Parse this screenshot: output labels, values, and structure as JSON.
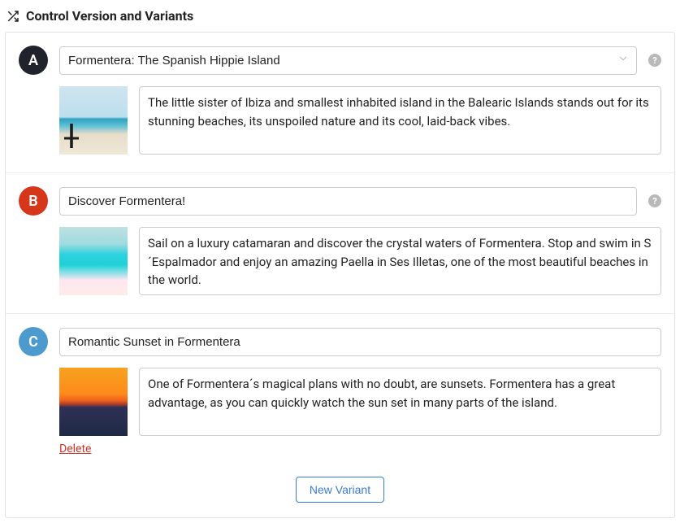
{
  "header": {
    "title": "Control Version and Variants"
  },
  "variants": [
    {
      "letter": "A",
      "badge_color": "#20232b",
      "title": "Formentera: The Spanish Hippie Island",
      "has_chevron": true,
      "has_help": true,
      "thumb_class": "thumb-a",
      "description": "The little sister of Ibiza and smallest inhabited island in the Balearic Islands stands out for its stunning beaches, its unspoiled nature and its cool, laid-back vibes.",
      "show_delete": false
    },
    {
      "letter": "B",
      "badge_color": "#d6361a",
      "title": "Discover Formentera!",
      "has_chevron": false,
      "has_help": true,
      "thumb_class": "thumb-b",
      "description": "Sail on a luxury catamaran and discover the crystal waters of Formentera. Stop and swim in S´Espalmador and enjoy an amazing Paella in Ses Illetas, one of the most beautiful beaches in the world.",
      "show_delete": false
    },
    {
      "letter": "C",
      "badge_color": "#4d9bce",
      "title": "Romantic Sunset in Formentera",
      "has_chevron": false,
      "has_help": false,
      "thumb_class": "thumb-c",
      "description": "One of Formentera´s magical plans with no doubt, are sunsets. Formentera has a great advantage, as you can quickly watch the sun set in many parts of the island.",
      "show_delete": true
    }
  ],
  "labels": {
    "delete": "Delete",
    "new_variant": "New Variant",
    "help_symbol": "?"
  }
}
